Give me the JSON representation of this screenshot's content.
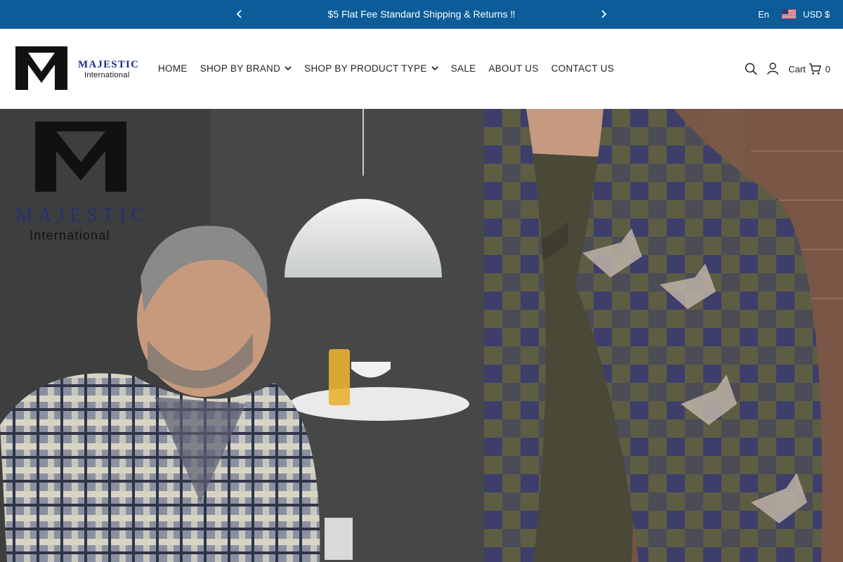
{
  "announcement": {
    "message": "$5 Flat Fee Standard Shipping & Returns ‼",
    "prev_icon": "chevron-left-icon",
    "next_icon": "chevron-right-icon"
  },
  "locale": {
    "language": "En",
    "currency": "USD $",
    "flag_icon": "us-flag-icon"
  },
  "header": {
    "logo": {
      "wordmark": "MAJESTIC",
      "subtitle": "International"
    },
    "nav": [
      {
        "label": "HOME",
        "has_dropdown": false
      },
      {
        "label": "SHOP BY BRAND",
        "has_dropdown": true
      },
      {
        "label": "SHOP BY PRODUCT TYPE",
        "has_dropdown": true
      },
      {
        "label": "SALE",
        "has_dropdown": false
      },
      {
        "label": "ABOUT US",
        "has_dropdown": false
      },
      {
        "label": "CONTACT US",
        "has_dropdown": false
      }
    ],
    "tools": {
      "search_icon": "search-icon",
      "account_icon": "user-icon",
      "cart_label": "Cart",
      "cart_icon": "cart-icon",
      "cart_count": "0"
    }
  },
  "hero": {
    "logo_wordmark": "MAJESTIC",
    "logo_subtitle": "International"
  },
  "colors": {
    "announcement_bg": "#0b5c99",
    "brand_blue": "#1a2a8a",
    "text": "#222222"
  }
}
